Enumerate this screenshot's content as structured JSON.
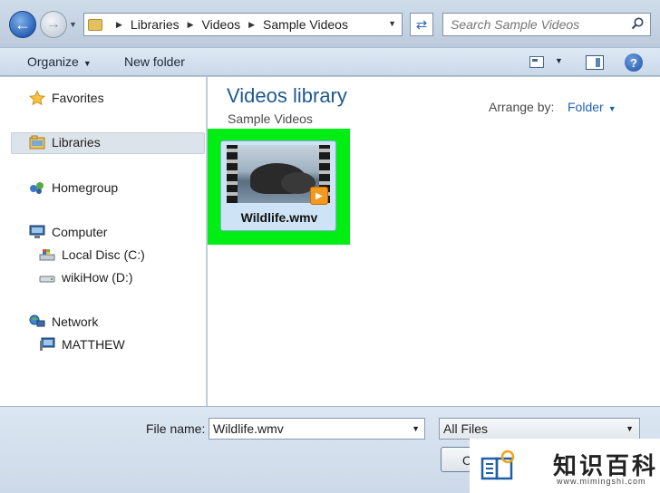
{
  "address_bar": {
    "breadcrumbs": [
      "Libraries",
      "Videos",
      "Sample Videos"
    ],
    "search_placeholder": "Search Sample Videos"
  },
  "toolbar": {
    "organize_label": "Organize",
    "new_folder_label": "New folder"
  },
  "navigation": {
    "items": [
      {
        "label": "Favorites",
        "icon": "star-icon"
      },
      {
        "label": "Libraries",
        "icon": "libraries-icon",
        "selected": true
      },
      {
        "label": "Homegroup",
        "icon": "homegroup-icon"
      },
      {
        "label": "Computer",
        "icon": "computer-icon"
      },
      {
        "label": "Local Disc (C:)",
        "icon": "local-disk-icon"
      },
      {
        "label": "wikiHow (D:)",
        "icon": "drive-icon"
      },
      {
        "label": "Network",
        "icon": "network-icon"
      },
      {
        "label": "MATTHEW",
        "icon": "network-computer-icon"
      }
    ]
  },
  "content": {
    "library_title": "Videos library",
    "library_subtitle": "Sample Videos",
    "arrange_label": "Arrange by:",
    "arrange_value": "Folder",
    "files": [
      {
        "name": "Wildlife.wmv",
        "type": "video",
        "selected": true
      }
    ],
    "highlight_color": "#00ee13"
  },
  "bottom": {
    "file_name_label": "File name:",
    "file_name_value": "Wildlife.wmv",
    "filter_value": "All Files",
    "open_button_label": "Open"
  },
  "watermark": {
    "text": "知识百科",
    "url": "www.mimingshi.com"
  },
  "colors": {
    "accent_blue": "#1e5a8e",
    "link_blue": "#1f62b3",
    "selection_bg": "#cfe3f7"
  }
}
